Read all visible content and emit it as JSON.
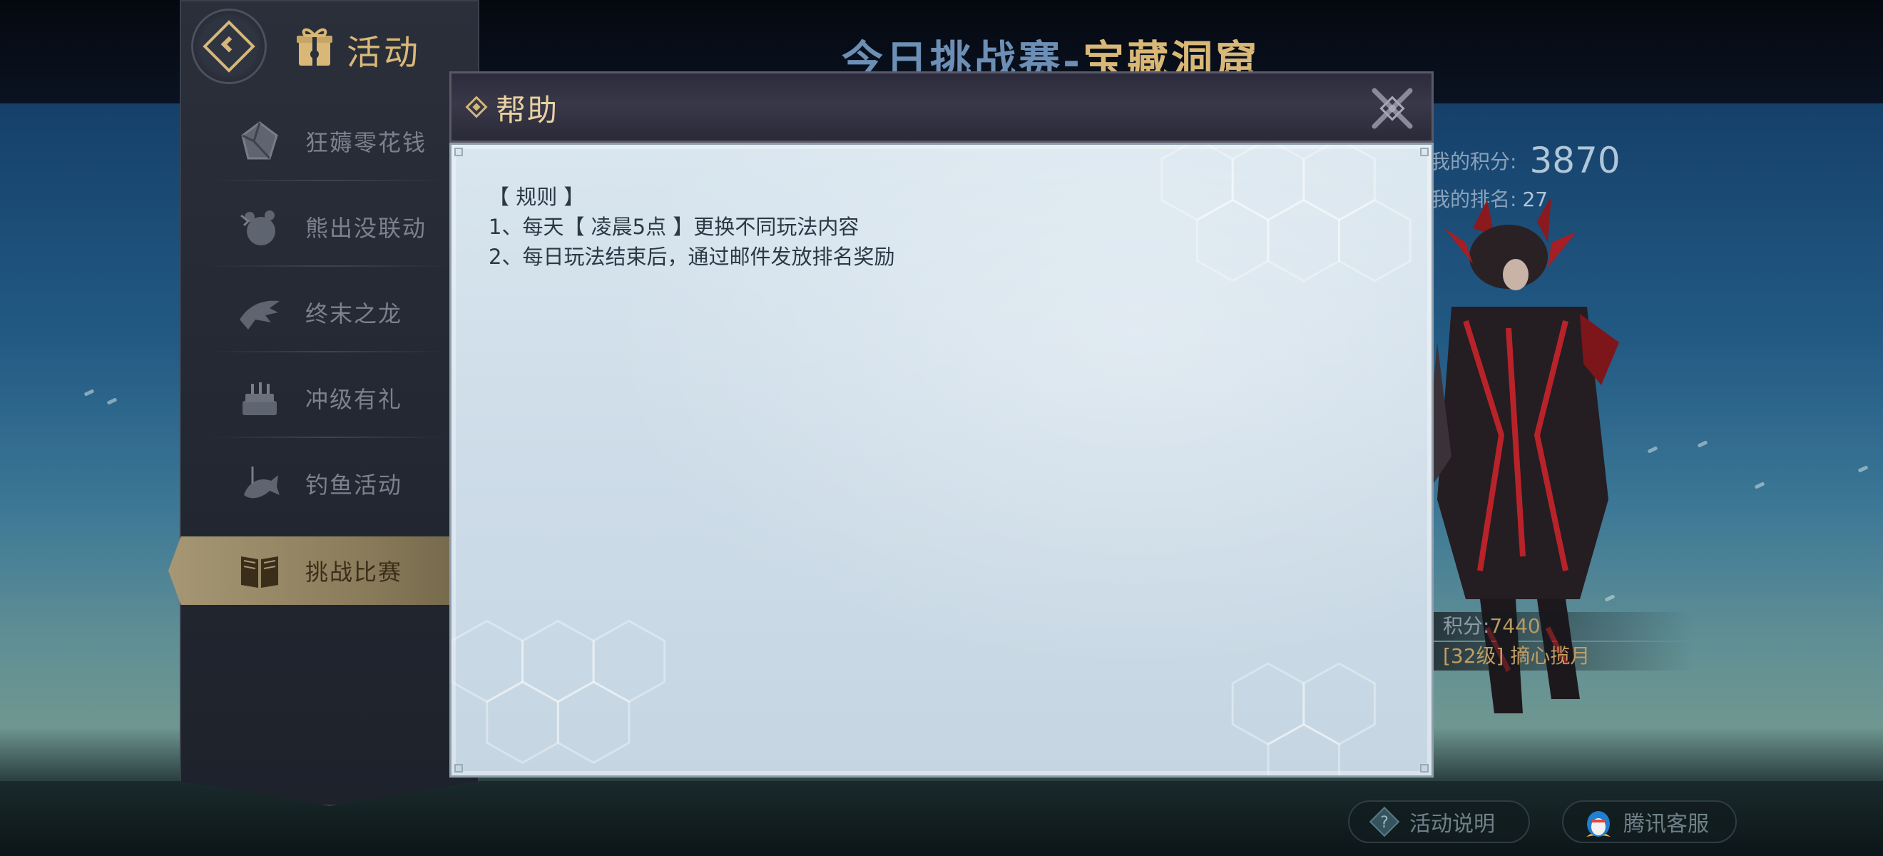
{
  "page": {
    "title_prefix": "今日挑战赛-",
    "title_main": "宝藏洞窟"
  },
  "sidebar": {
    "title": "活动",
    "back_icon": "back-diamond-icon",
    "items": [
      {
        "label": "狂薅零花钱",
        "icon": "crystal-icon",
        "active": false
      },
      {
        "label": "熊出没联动",
        "icon": "bear-icon",
        "active": false
      },
      {
        "label": "终末之龙",
        "icon": "dragon-icon",
        "active": false
      },
      {
        "label": "冲级有礼",
        "icon": "cake-icon",
        "active": false
      },
      {
        "label": "钓鱼活动",
        "icon": "fish-icon",
        "active": false
      },
      {
        "label": "挑战比赛",
        "icon": "book-icon",
        "active": true
      }
    ]
  },
  "stats": {
    "my_score_label": "我的积分:",
    "my_score_value": "3870",
    "my_rank_label": "我的排名:",
    "my_rank_value": "27"
  },
  "character": {
    "score_label": "积分:",
    "score_value": "7440",
    "name": "[32级] 摘心揽月"
  },
  "bottom": {
    "rules_button": "活动说明",
    "service_button": "腾讯客服"
  },
  "modal": {
    "title": "帮助",
    "close_icon": "close-x-icon",
    "lines": [
      "【 规则 】",
      "1、每天【 凌晨5点 】更换不同玩法内容",
      "2、每日玩法结束后，通过邮件发放排名奖励"
    ]
  },
  "colors": {
    "gold": "#d9b877",
    "modal_body": "#d3e1eb",
    "modal_header": "#34334a",
    "active_menu": "#a69774"
  }
}
